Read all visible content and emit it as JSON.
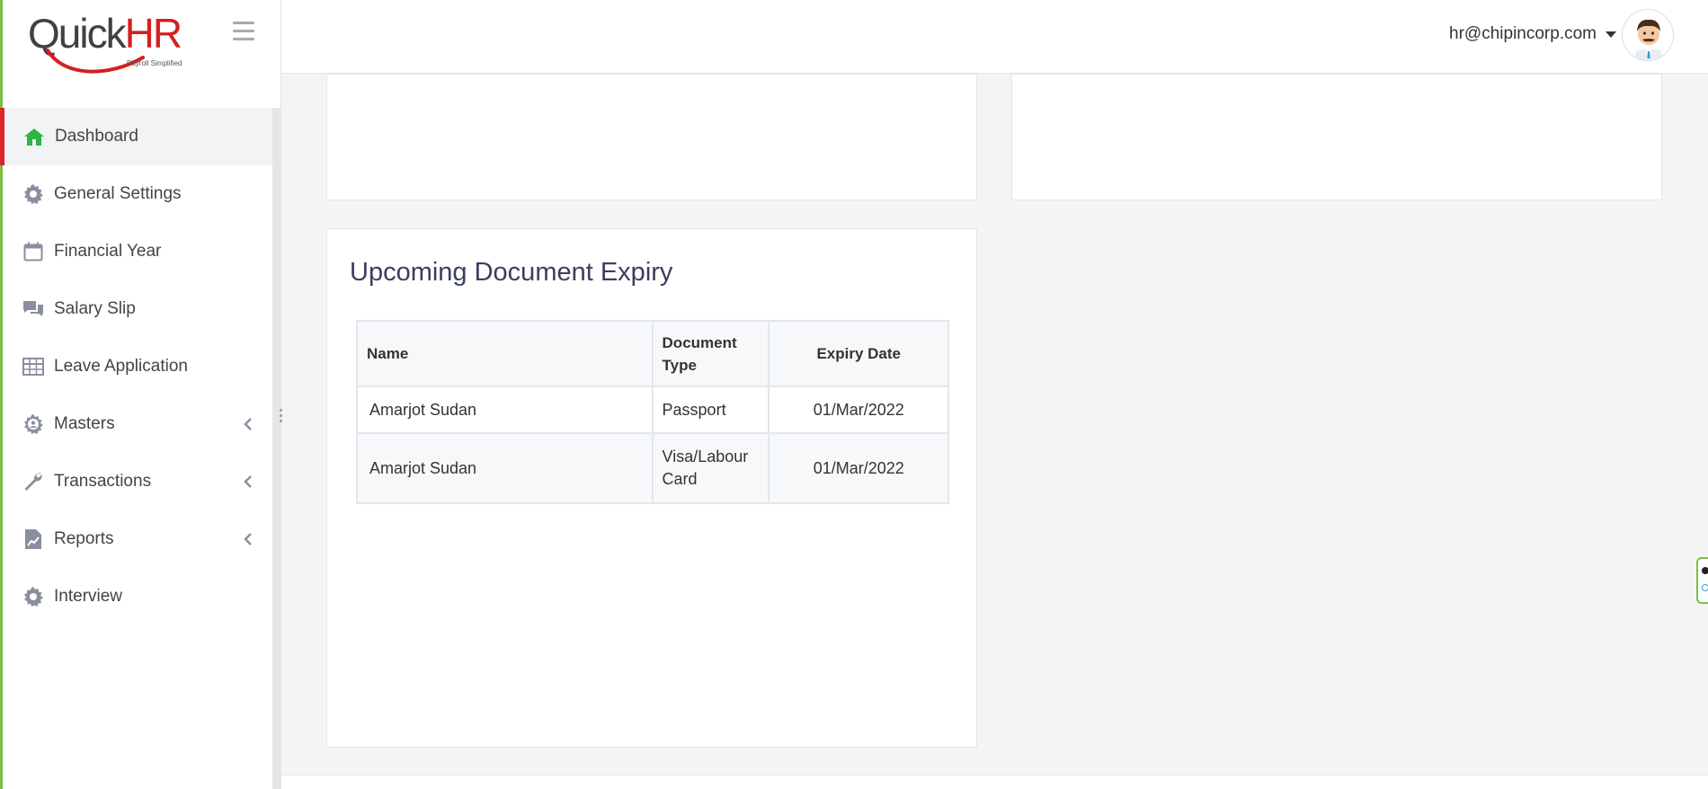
{
  "brand": {
    "name_quick": "Quick",
    "name_hr": "HR",
    "tagline": "Payroll Simplified"
  },
  "header": {
    "user_email": "hr@chipincorp.com"
  },
  "sidebar": {
    "items": [
      {
        "label": "Dashboard",
        "icon": "home-icon",
        "active": true
      },
      {
        "label": "General Settings",
        "icon": "gear-icon"
      },
      {
        "label": "Financial Year",
        "icon": "calendar-icon"
      },
      {
        "label": "Salary Slip",
        "icon": "chat-icon"
      },
      {
        "label": "Leave Application",
        "icon": "table-icon"
      },
      {
        "label": "Masters",
        "icon": "user-gear-icon",
        "expandable": true
      },
      {
        "label": "Transactions",
        "icon": "wrench-icon",
        "expandable": true
      },
      {
        "label": "Reports",
        "icon": "report-icon",
        "expandable": true
      },
      {
        "label": "Interview",
        "icon": "gear-icon"
      }
    ]
  },
  "document_expiry": {
    "title": "Upcoming Document Expiry",
    "columns": [
      "Name",
      "Document Type",
      "Expiry Date"
    ],
    "rows": [
      {
        "name": "Amarjot Sudan",
        "doc_type": "Passport",
        "expiry": "01/Mar/2022"
      },
      {
        "name": "Amarjot Sudan",
        "doc_type": "Visa/Labour Card",
        "expiry": "01/Mar/2022"
      }
    ]
  },
  "colors": {
    "accent_green": "#7bc043",
    "active_red": "#d9262c",
    "icon_gray": "#8a8fa0",
    "home_green": "#2fb344"
  }
}
